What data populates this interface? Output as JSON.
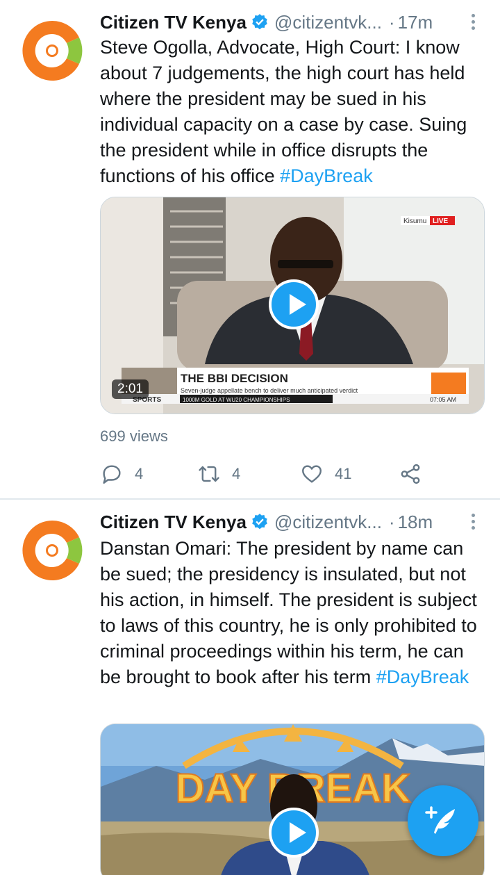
{
  "tweets": [
    {
      "author_name": "Citizen TV Kenya",
      "handle": "@citizentvk...",
      "separator": "·",
      "time": "17m",
      "text": "Steve Ogolla, Advocate, High Court: I know about 7 judgements, the high court has held where the president may be sued in his individual capacity on a case by case. Suing the president while in office disrupts the functions of his office ",
      "hashtag": "#DayBreak",
      "video": {
        "duration": "2:01",
        "location_tag": "Kisumu",
        "live_tag": "LIVE",
        "headline": "THE BBI DECISION",
        "subheadline": "Seven-judge appellate bench to deliver much anticipated verdict",
        "ticker_label": "SPORTS",
        "ticker_text": "1000M GOLD AT WU20 CHAMPIONSHIPS",
        "clock": "07:05 AM"
      },
      "views": "699 views",
      "replies": "4",
      "retweets": "4",
      "likes": "41"
    },
    {
      "author_name": "Citizen TV Kenya",
      "handle": "@citizentvk...",
      "separator": "·",
      "time": "18m",
      "text": "Danstan Omari: The president by name can be sued; the presidency is insulated, but not his action, in himself. The president is subject to laws of this country, he is only prohibited to criminal proceedings within his term, he can be brought to book after his term ",
      "hashtag": "#DayBreak",
      "video": {
        "banner_text": "DAY BREAK"
      }
    }
  ],
  "icons": {
    "verified": "verified-badge-icon",
    "more": "more-vertical-icon",
    "play": "play-icon",
    "reply": "reply-icon",
    "retweet": "retweet-icon",
    "like": "heart-icon",
    "share": "share-icon",
    "compose": "compose-tweet-icon"
  },
  "colors": {
    "accent": "#1da1f2",
    "secondary_text": "#657786",
    "citizen_orange": "#f47b20",
    "citizen_green": "#8dc63f"
  }
}
